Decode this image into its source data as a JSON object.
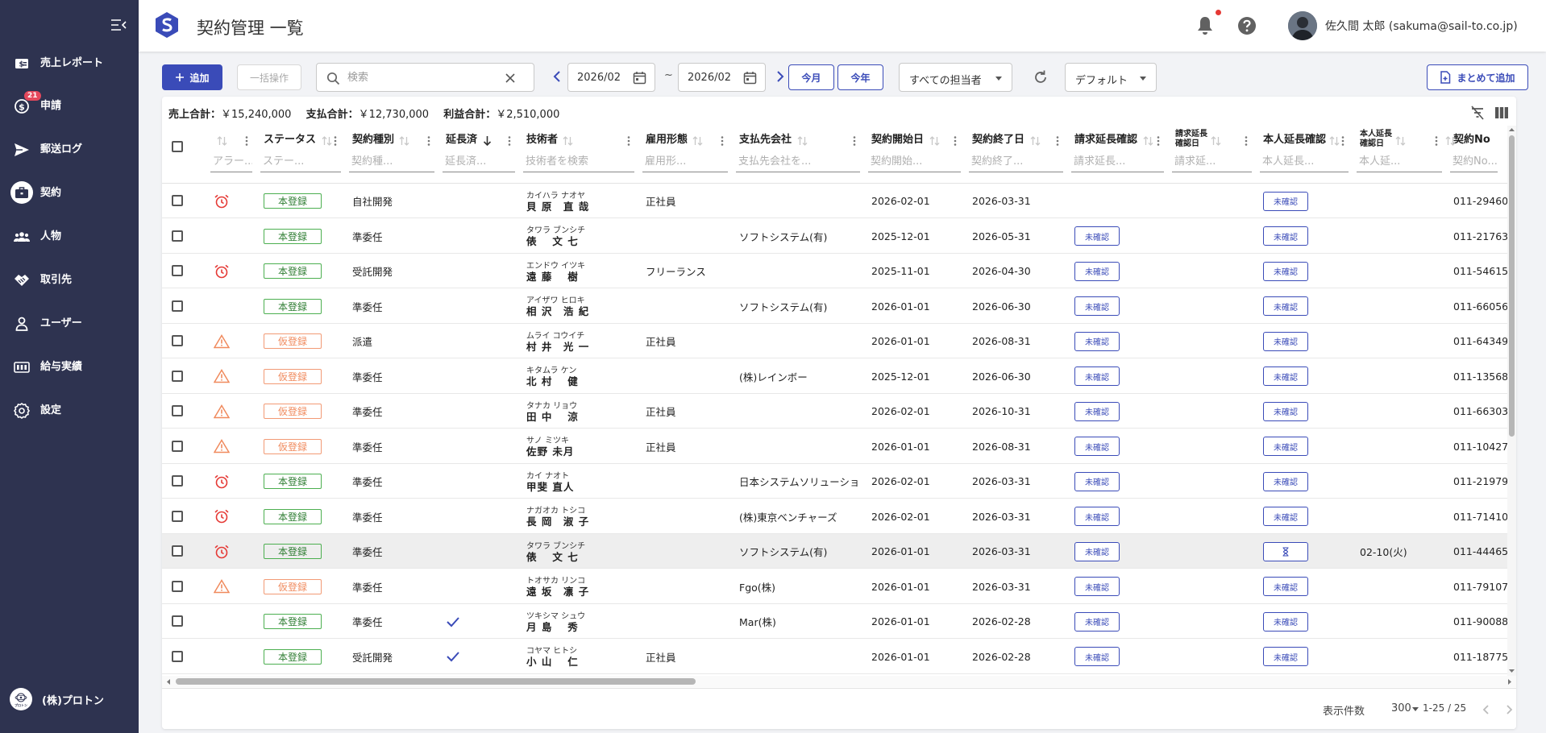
{
  "sidebar": {
    "items": [
      {
        "label": "売上レポート",
        "icon": "cash-icon"
      },
      {
        "label": "申請",
        "icon": "dollar-circle-icon",
        "badge": "21"
      },
      {
        "label": "郵送ログ",
        "icon": "send-icon"
      },
      {
        "label": "契約",
        "icon": "briefcase-icon",
        "active": true
      },
      {
        "label": "人物",
        "icon": "people-icon"
      },
      {
        "label": "取引先",
        "icon": "handshake-icon"
      },
      {
        "label": "ユーザー",
        "icon": "user-icon"
      },
      {
        "label": "給与実績",
        "icon": "payroll-icon"
      },
      {
        "label": "設定",
        "icon": "gear-icon"
      }
    ],
    "org_name": "(株)プロトン",
    "org_logo_text": "プロトン"
  },
  "header": {
    "title": "契約管理 一覧",
    "user": "佐久間 太郎 (sakuma@sail-to.co.jp)"
  },
  "toolbar": {
    "add_label": "追加",
    "bulk_label": "一括操作",
    "search_placeholder": "検索",
    "date_from": "2026/02",
    "date_to": "2026/02",
    "tilde": "~",
    "this_month": "今月",
    "this_year": "今年",
    "assignee": "すべての担当者",
    "view": "デフォルト",
    "bulk_add": "まとめて追加"
  },
  "totals": {
    "sales_label": "売上合計：",
    "sales": "￥15,240,000",
    "pay_label": "支払合計：",
    "pay": "￥12,730,000",
    "profit_label": "利益合計：",
    "profit": "￥2,510,000"
  },
  "columns": [
    {
      "title": "",
      "filter": "アラー..."
    },
    {
      "title": "ステータス",
      "filter": "ステー..."
    },
    {
      "title": "契約種別",
      "filter": "契約種..."
    },
    {
      "title": "延長済",
      "filter": "延長済..."
    },
    {
      "title": "技術者",
      "filter": "技術者を検索"
    },
    {
      "title": "雇用形態",
      "filter": "雇用形..."
    },
    {
      "title": "支払先会社",
      "filter": "支払先会社を..."
    },
    {
      "title": "契約開始日",
      "filter": "契約開始..."
    },
    {
      "title": "契約終了日",
      "filter": "契約終了..."
    },
    {
      "title": "請求延長確認",
      "filter": "請求延長..."
    },
    {
      "title": "請求延長\n確認日",
      "filter": "請求延..."
    },
    {
      "title": "本人延長確認",
      "filter": "本人延長..."
    },
    {
      "title": "本人延長\n確認日",
      "filter": "本人延..."
    },
    {
      "title": "契約No",
      "filter": "契約No..."
    }
  ],
  "rows": [
    {
      "alert": "alarm",
      "status": "本登録",
      "type": "自社開発",
      "ext": false,
      "kana": "カイハラ ナオヤ",
      "name": "貝 原　直 哉",
      "emp": "正社員",
      "payee": "",
      "start": "2026-02-01",
      "end": "2026-03-31",
      "bill": "",
      "bill_date": "",
      "self": "未確認",
      "self_date": "",
      "no": "011-29460"
    },
    {
      "alert": "",
      "status": "本登録",
      "type": "準委任",
      "ext": false,
      "kana": "タワラ ブンシチ",
      "name": "俵　 文 七",
      "emp": "",
      "payee": "ソフトシステム(有)",
      "start": "2025-12-01",
      "end": "2026-05-31",
      "bill": "未確認",
      "bill_date": "",
      "self": "未確認",
      "self_date": "",
      "no": "011-21763"
    },
    {
      "alert": "alarm",
      "status": "本登録",
      "type": "受託開発",
      "ext": false,
      "kana": "エンドウ イツキ",
      "name": "遠 藤　 樹",
      "emp": "フリーランス",
      "payee": "",
      "start": "2025-11-01",
      "end": "2026-04-30",
      "bill": "未確認",
      "bill_date": "",
      "self": "未確認",
      "self_date": "",
      "no": "011-54615"
    },
    {
      "alert": "",
      "status": "本登録",
      "type": "準委任",
      "ext": false,
      "kana": "アイザワ ヒロキ",
      "name": "相 沢　浩 紀",
      "emp": "",
      "payee": "ソフトシステム(有)",
      "start": "2026-01-01",
      "end": "2026-06-30",
      "bill": "未確認",
      "bill_date": "",
      "self": "未確認",
      "self_date": "",
      "no": "011-66056"
    },
    {
      "alert": "warn",
      "status": "仮登録",
      "type": "派遣",
      "ext": false,
      "kana": "ムライ コウイチ",
      "name": "村 井　光 一",
      "emp": "正社員",
      "payee": "",
      "start": "2026-01-01",
      "end": "2026-08-31",
      "bill": "未確認",
      "bill_date": "",
      "self": "未確認",
      "self_date": "",
      "no": "011-64349"
    },
    {
      "alert": "warn",
      "status": "仮登録",
      "type": "準委任",
      "ext": false,
      "kana": "キタムラ ケン",
      "name": "北 村　 健",
      "emp": "",
      "payee": "(株)レインボー",
      "start": "2025-12-01",
      "end": "2026-06-30",
      "bill": "未確認",
      "bill_date": "",
      "self": "未確認",
      "self_date": "",
      "no": "011-13568"
    },
    {
      "alert": "warn",
      "status": "仮登録",
      "type": "準委任",
      "ext": false,
      "kana": "タナカ リョウ",
      "name": "田 中　 涼",
      "emp": "正社員",
      "payee": "",
      "start": "2026-02-01",
      "end": "2026-10-31",
      "bill": "未確認",
      "bill_date": "",
      "self": "未確認",
      "self_date": "",
      "no": "011-66303"
    },
    {
      "alert": "warn",
      "status": "仮登録",
      "type": "準委任",
      "ext": false,
      "kana": "サノ ミツキ",
      "name": "佐野 未月",
      "emp": "正社員",
      "payee": "",
      "start": "2026-01-01",
      "end": "2026-08-31",
      "bill": "未確認",
      "bill_date": "",
      "self": "未確認",
      "self_date": "",
      "no": "011-10427"
    },
    {
      "alert": "alarm",
      "status": "本登録",
      "type": "準委任",
      "ext": false,
      "kana": "カイ ナオト",
      "name": "甲斐 直人",
      "emp": "",
      "payee": "日本システムソリューショ",
      "start": "2026-02-01",
      "end": "2026-03-31",
      "bill": "未確認",
      "bill_date": "",
      "self": "未確認",
      "self_date": "",
      "no": "011-21979"
    },
    {
      "alert": "alarm",
      "status": "本登録",
      "type": "準委任",
      "ext": false,
      "kana": "ナガオカ トシコ",
      "name": "長 岡　淑 子",
      "emp": "",
      "payee": "(株)東京ベンチャーズ",
      "start": "2026-02-01",
      "end": "2026-03-31",
      "bill": "未確認",
      "bill_date": "",
      "self": "未確認",
      "self_date": "",
      "no": "011-71410"
    },
    {
      "alert": "alarm",
      "status": "本登録",
      "type": "準委任",
      "ext": false,
      "kana": "タワラ ブンシチ",
      "name": "俵　 文 七",
      "emp": "",
      "payee": "ソフトシステム(有)",
      "start": "2026-01-01",
      "end": "2026-03-31",
      "bill": "未確認",
      "bill_date": "",
      "self": "hourglass",
      "self_date": "02-10(火)",
      "no": "011-44465",
      "selected": true
    },
    {
      "alert": "warn",
      "status": "仮登録",
      "type": "準委任",
      "ext": false,
      "kana": "トオサカ リンコ",
      "name": "遠 坂　凛 子",
      "emp": "",
      "payee": "Fgo(株)",
      "start": "2026-01-01",
      "end": "2026-03-31",
      "bill": "未確認",
      "bill_date": "",
      "self": "未確認",
      "self_date": "",
      "no": "011-79107"
    },
    {
      "alert": "",
      "status": "本登録",
      "type": "準委任",
      "ext": true,
      "kana": "ツキシマ シュウ",
      "name": "月 島　 秀",
      "emp": "",
      "payee": "Mar(株)",
      "start": "2026-01-01",
      "end": "2026-02-28",
      "bill": "未確認",
      "bill_date": "",
      "self": "未確認",
      "self_date": "",
      "no": "011-90088"
    },
    {
      "alert": "",
      "status": "本登録",
      "type": "受託開発",
      "ext": true,
      "kana": "コヤマ ヒトシ",
      "name": "小 山　 仁",
      "emp": "正社員",
      "payee": "",
      "start": "2026-01-01",
      "end": "2026-02-28",
      "bill": "未確認",
      "bill_date": "",
      "self": "未確認",
      "self_date": "",
      "no": "011-18775"
    }
  ],
  "footer": {
    "per_page_label": "表示件数",
    "per_page": "300",
    "range": "1-25 / 25"
  },
  "colors": {
    "sidebar": "#2e3350",
    "primary": "#3a4bb8",
    "status_ok": "#4caf50",
    "status_tmp": "#f08a5d",
    "alarm": "#e53935",
    "warn": "#f08a5d"
  }
}
